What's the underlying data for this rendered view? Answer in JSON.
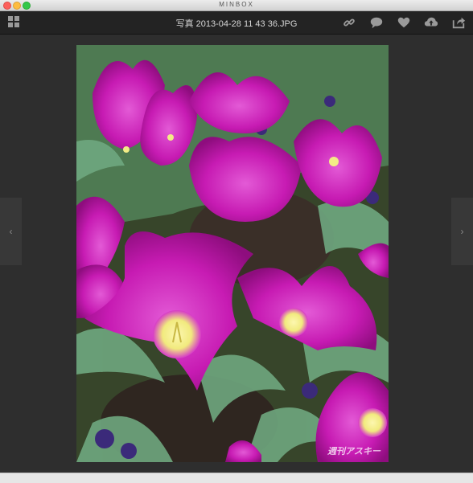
{
  "window": {
    "app_title": "MINBOX"
  },
  "toolbar": {
    "file_title": "写真 2013-04-28 11 43 36.JPG",
    "icons": [
      "grid-icon",
      "link-icon",
      "comment-icon",
      "heart-icon",
      "cloud-upload-icon",
      "share-icon"
    ]
  },
  "viewer": {
    "prev_label": "‹",
    "next_label": "›",
    "watermark": "週刊アスキー"
  },
  "colors": {
    "tulip": "#c81ab4",
    "tulip_light": "#e24fd2",
    "leaf": "#6aa27a",
    "soil": "#3a2f28",
    "pansy": "#3b2a7a"
  }
}
